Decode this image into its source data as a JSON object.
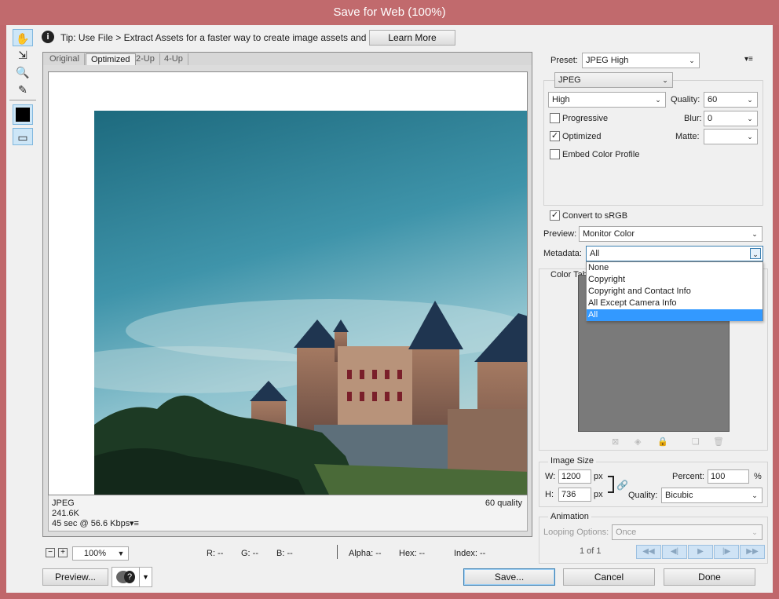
{
  "window": {
    "title": "Save for Web (100%)"
  },
  "tip": {
    "text": "Tip: Use File > Extract Assets for a faster way to create image assets and SVG",
    "button": "Learn More"
  },
  "tools": [
    "hand-tool",
    "slice-select-tool",
    "zoom-tool",
    "eyedropper-tool",
    "eyedropper-color",
    "toggle-slices"
  ],
  "tabs": [
    "Original",
    "Optimized",
    "2-Up",
    "4-Up"
  ],
  "image_info": {
    "format": "JPEG",
    "size": "241.6K",
    "time": "45 sec @ 56.6 Kbps",
    "quality": "60 quality"
  },
  "statusbar": {
    "zoom": "100%",
    "r": "R: --",
    "g": "G: --",
    "b": "B: --",
    "alpha": "Alpha: --",
    "hex": "Hex: --",
    "index": "Index: --"
  },
  "settings": {
    "preset_label": "Preset:",
    "preset_value": "JPEG High",
    "format": "JPEG",
    "quality_level": "High",
    "quality_label": "Quality:",
    "quality_value": "60",
    "progressive": "Progressive",
    "blur_label": "Blur:",
    "blur_value": "0",
    "optimized": "Optimized",
    "matte_label": "Matte:",
    "embed": "Embed Color Profile",
    "convert": "Convert to sRGB",
    "preview_label": "Preview:",
    "preview_value": "Monitor Color",
    "metadata_label": "Metadata:",
    "metadata_value": "All",
    "color_table_label": "Color Tab"
  },
  "metadata_options": [
    "None",
    "Copyright",
    "Copyright and Contact Info",
    "All Except Camera Info",
    "All"
  ],
  "image_size": {
    "title": "Image Size",
    "w_label": "W:",
    "w_value": "1200",
    "h_label": "H:",
    "h_value": "736",
    "unit": "px",
    "percent_label": "Percent:",
    "percent_value": "100",
    "percent_unit": "%",
    "quality_label": "Quality:",
    "quality_value": "Bicubic"
  },
  "animation": {
    "title": "Animation",
    "looping_label": "Looping Options:",
    "looping_value": "Once",
    "frame": "1 of 1"
  },
  "buttons": {
    "preview": "Preview...",
    "save": "Save...",
    "cancel": "Cancel",
    "done": "Done"
  },
  "colors": {
    "titlebar": "#c16a6d",
    "selection": "#3399ff"
  }
}
